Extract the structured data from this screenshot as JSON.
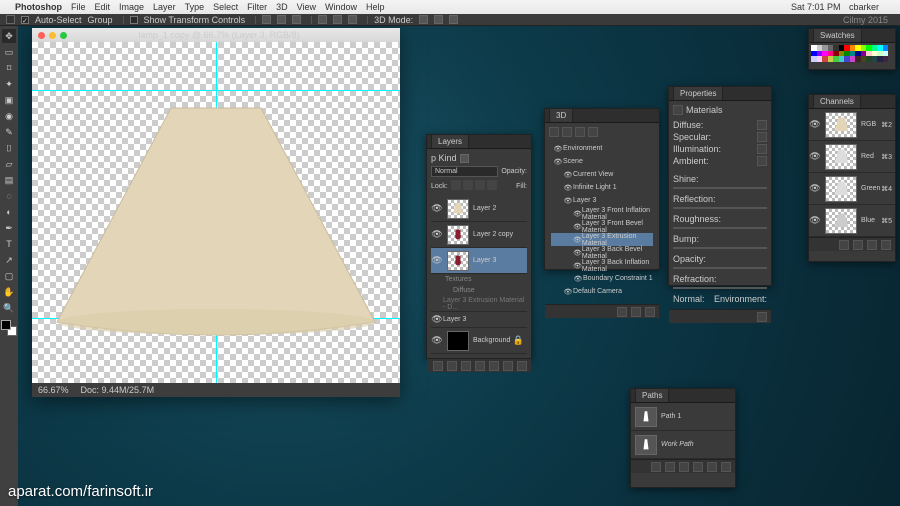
{
  "menubar": {
    "app": "Photoshop",
    "items": [
      "File",
      "Edit",
      "Image",
      "Layer",
      "Type",
      "Select",
      "Filter",
      "3D",
      "View",
      "Window",
      "Help"
    ],
    "status_time": "Sat 7:01 PM",
    "user": "cbarker"
  },
  "optbar": {
    "tool": "Auto-Select",
    "group": "Group",
    "transform": "Show Transform Controls",
    "mode": "3D Mode:"
  },
  "doc": {
    "title": "lamp_1 copy @ 66.7% (Layer 3, RGB/8)",
    "zoom": "66.67%",
    "docsize": "Doc: 9.44M/25.7M"
  },
  "layers": {
    "title": "Layers",
    "kind": "p Kind",
    "blend": "Normal",
    "opacity_label": "Opacity:",
    "lock_label": "Lock:",
    "fill_label": "Fill:",
    "items": [
      {
        "name": "Layer 2",
        "selected": false,
        "thumb": "shade"
      },
      {
        "name": "Layer 2 copy",
        "selected": false,
        "thumb": "vase"
      },
      {
        "name": "Layer 3",
        "selected": true,
        "thumb": "vase"
      }
    ],
    "textures_label": "Textures",
    "diffuse_label": "Diffuse",
    "tex1": "Layer 3 Extrusion Material - D...",
    "sub_layer": "Layer 3",
    "bg": "Background"
  },
  "panel3d": {
    "title": "3D",
    "env": "Environment",
    "scene": "Scene",
    "items": [
      {
        "name": "Current View",
        "indent": 1
      },
      {
        "name": "Infinite Light 1",
        "indent": 1
      },
      {
        "name": "Layer 3",
        "indent": 1
      },
      {
        "name": "Layer 3 Front Inflation Material",
        "indent": 2
      },
      {
        "name": "Layer 3 Front Bevel Material",
        "indent": 2
      },
      {
        "name": "Layer 3 Extrusion Material",
        "indent": 2,
        "sel": true
      },
      {
        "name": "Layer 3 Back Bevel Material",
        "indent": 2
      },
      {
        "name": "Layer 3 Back Inflation Material",
        "indent": 2
      },
      {
        "name": "Boundary Constraint 1",
        "indent": 2
      },
      {
        "name": "Default Camera",
        "indent": 1
      }
    ]
  },
  "props": {
    "title": "Properties",
    "sub": "Materials",
    "rows": [
      {
        "label": "Diffuse:",
        "val": ""
      },
      {
        "label": "Specular:",
        "val": ""
      },
      {
        "label": "Illumination:",
        "val": ""
      },
      {
        "label": "Ambient:",
        "val": ""
      }
    ],
    "sliders": [
      "Shine:",
      "Reflection:",
      "Roughness:",
      "Bump:",
      "Opacity:",
      "Refraction:"
    ],
    "normal": "Normal:",
    "env": "Environment:"
  },
  "swatches": {
    "title": "Swatches"
  },
  "channels": {
    "title": "Channels",
    "items": [
      {
        "name": "RGB",
        "key": "⌘2"
      },
      {
        "name": "Red",
        "key": "⌘3"
      },
      {
        "name": "Green",
        "key": "⌘4"
      },
      {
        "name": "Blue",
        "key": "⌘5"
      }
    ]
  },
  "paths": {
    "title": "Paths",
    "items": [
      "Path 1",
      "Work Path"
    ]
  },
  "watermark": "aparat.com/farinsoft.ir",
  "company": "Cilmy 2015"
}
